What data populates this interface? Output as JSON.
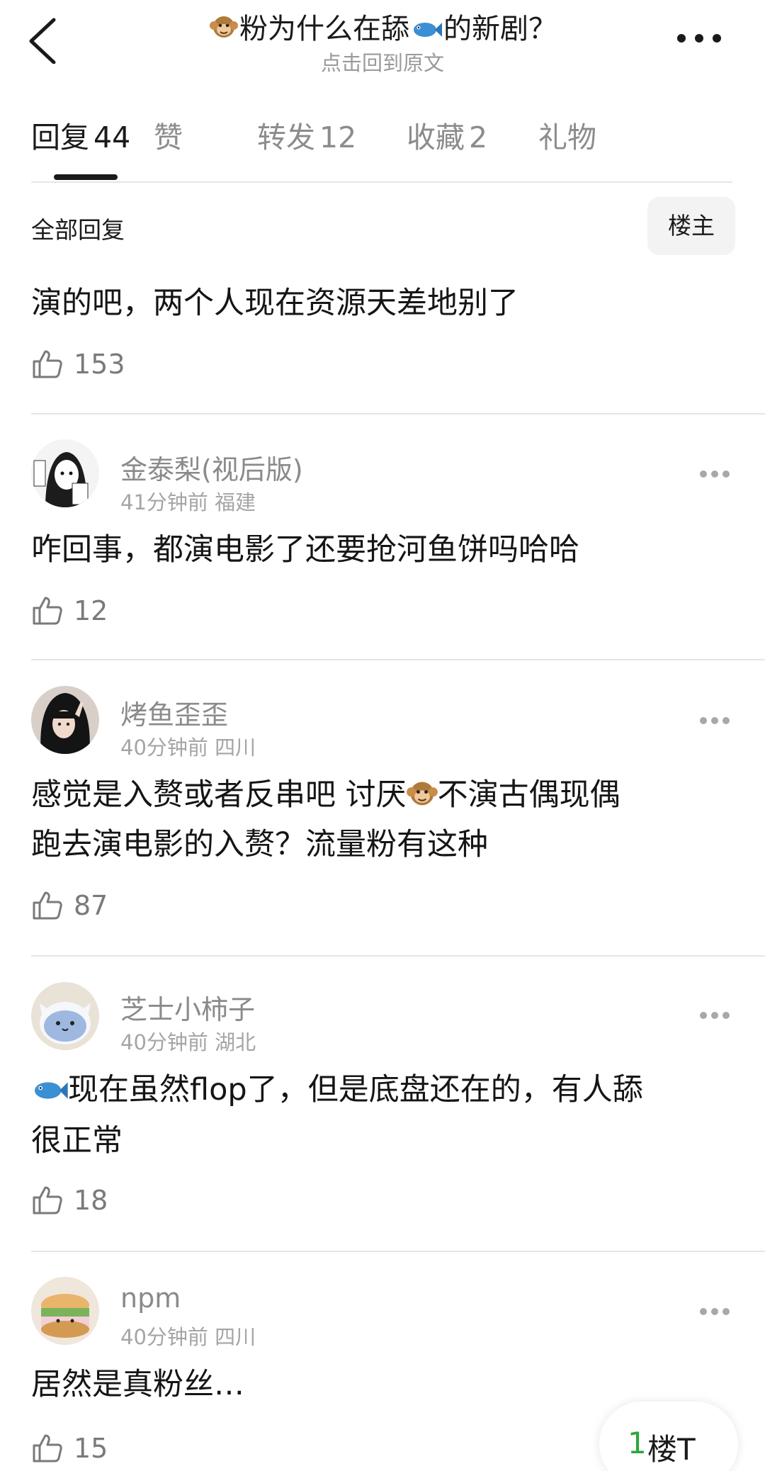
{
  "header": {
    "title_pre": "粉为什么在舔",
    "title_post": "的新剧？",
    "subtitle": "点击回到原文"
  },
  "tabs": [
    {
      "label": "回复",
      "count": "44"
    },
    {
      "label": "赞",
      "count": ""
    },
    {
      "label": "转发",
      "count": "12"
    },
    {
      "label": "收藏",
      "count": "2"
    },
    {
      "label": "礼物",
      "count": ""
    }
  ],
  "filter": {
    "label": "全部回复",
    "op_only": "楼主"
  },
  "comments": [
    {
      "text": "演的吧，两个人现在资源天差地别了",
      "likes": "153"
    },
    {
      "username": "金泰梨(视后版)",
      "time": "41分钟前",
      "location": "福建",
      "text": "咋回事，都演电影了还要抢河鱼饼吗哈哈",
      "likes": "12"
    },
    {
      "username": "烤鱼歪歪",
      "time": "40分钟前",
      "location": "四川",
      "text_l1_pre": "感觉是入赘或者反串吧  讨厌",
      "text_l1_post": "不演古偶现偶",
      "text_l2": "跑去演电影的入赘？流量粉有这种",
      "likes": "87"
    },
    {
      "username": "芝士小柿子",
      "time": "40分钟前",
      "location": "湖北",
      "text_l1": "现在虽然flop了，但是底盘还在的，有人舔",
      "text_l2": "很正常",
      "likes": "18"
    },
    {
      "username": "npm",
      "time": "40分钟前",
      "location": "四川",
      "text": "居然是真粉丝…",
      "likes": "15"
    }
  ],
  "float_button": {
    "num": "1",
    "label": "楼T"
  },
  "colors": {
    "accent_green": "#2aa83a",
    "text_dark": "#1a1a1a",
    "text_gray": "#8a8a8a"
  }
}
